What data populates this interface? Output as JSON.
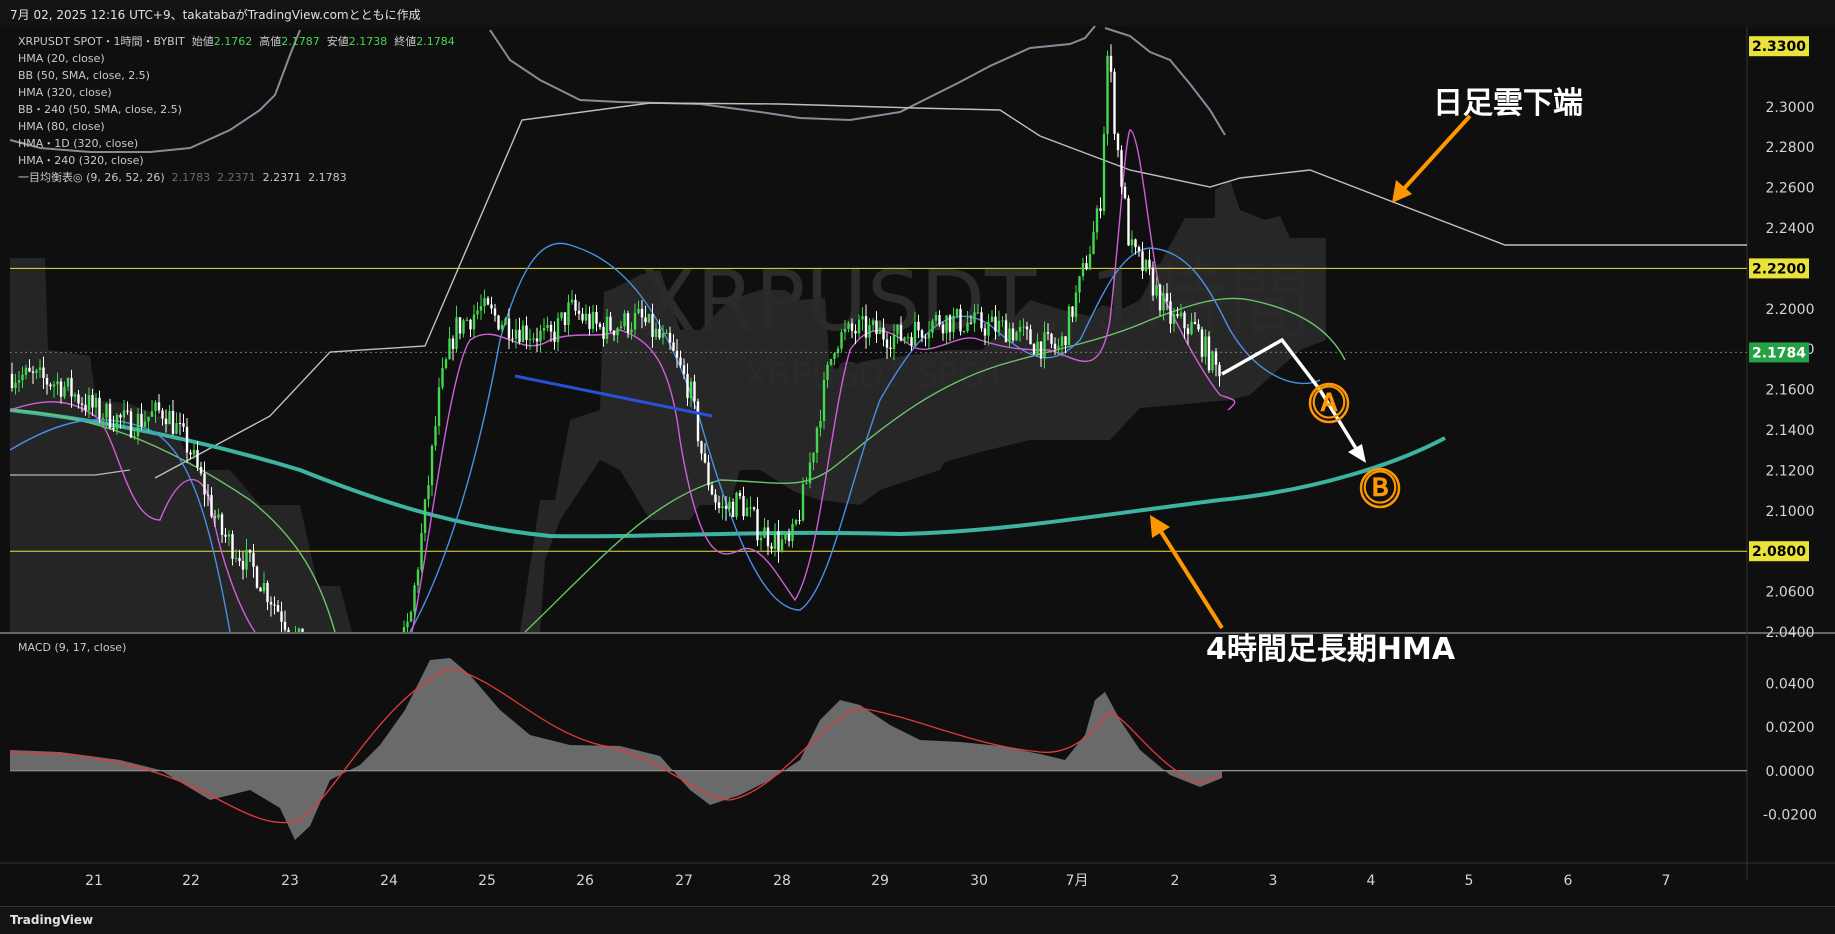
{
  "header": {
    "text": "7月 02, 2025 12:16 UTC+9、takatabaがTradingView.comとともに作成"
  },
  "legend": {
    "symbol": "XRPUSDT SPOT・1時間・BYBIT",
    "open_label": "始値",
    "open": "2.1762",
    "high_label": "高値",
    "high": "2.1787",
    "low_label": "安値",
    "low": "2.1738",
    "close_label": "終値",
    "close": "2.1784",
    "lines": [
      "HMA (20, close)",
      "BB (50, SMA, close, 2.5)",
      "HMA (320, close)",
      "BB・240 (50, SMA, close, 2.5)",
      "HMA (80, close)",
      "HMA・1D (320, close)",
      "HMA・240 (320, close)"
    ],
    "ichimoku": "一目均衡表◎ (9, 26, 52, 26)",
    "ichimoku_vals": [
      "2.1783",
      "2.2371",
      "2.2371",
      "2.1783"
    ]
  },
  "watermark": {
    "big": "XRPUSDT, 1時間",
    "small": "XRPUSDT SPOT"
  },
  "macd": {
    "title": "MACD (9, 17, close)"
  },
  "footer": {
    "logo": "TradingView"
  },
  "annotations": {
    "cloud": "日足雲下端",
    "hma": "4時間足長期HMA",
    "a": "Ⓐ",
    "b": "Ⓑ"
  },
  "colors": {
    "up": "#45d74f",
    "down": "#ffffff",
    "hma20": "#d05fd6",
    "bb": "#c0c0c0",
    "hma320": "#4a8fe6",
    "hma80": "#6bc46b",
    "hma240": "#3db3a1",
    "trend": "#2b50d8",
    "orange": "#ff9800",
    "hline": "#e8e23a"
  },
  "chart_data": {
    "type": "candlestick",
    "price_axis": {
      "ylim": [
        2.04,
        2.34
      ],
      "ticks": [
        "2.3000",
        "2.2800",
        "2.2600",
        "2.2400",
        "2.2000",
        "2.1800",
        "2.1600",
        "2.1400",
        "2.1200",
        "2.1000",
        "2.0600",
        "2.0400"
      ]
    },
    "price_tags": [
      {
        "value": "2.3300",
        "color": "#e8e23a"
      },
      {
        "value": "2.2200",
        "color": "#e8e23a"
      },
      {
        "value": "2.1784",
        "color": "#26a047"
      },
      {
        "value": "2.0800",
        "color": "#e8e23a"
      }
    ],
    "horizontal_lines": [
      2.22,
      2.08
    ],
    "macd_axis": {
      "ylim": [
        -0.04,
        0.06
      ],
      "ticks": [
        "0.0400",
        "0.0200",
        "0.0000",
        "-0.0200"
      ]
    },
    "x_labels": [
      "21",
      "22",
      "23",
      "24",
      "25",
      "26",
      "27",
      "28",
      "29",
      "30",
      "7月",
      "2",
      "3",
      "4",
      "5",
      "6",
      "7"
    ]
  }
}
